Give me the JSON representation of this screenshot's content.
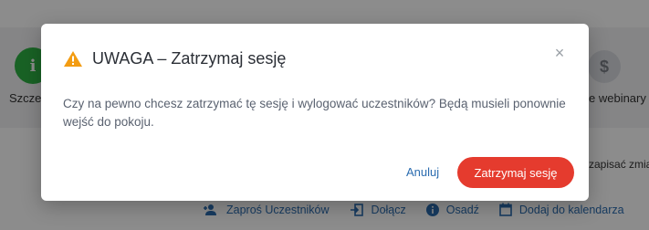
{
  "background": {
    "left_tab_icon": "info-icon",
    "left_tab_label": "Szczeg",
    "right_tab_icon": "dollar-icon",
    "right_tab_label": "e webinary",
    "save_note": "zapisać zmia",
    "actions": [
      {
        "icon": "invite-users-icon",
        "label": "Zaproś Uczestników"
      },
      {
        "icon": "join-icon",
        "label": "Dołącz"
      },
      {
        "icon": "info-icon",
        "label": "Osadź"
      },
      {
        "icon": "calendar-icon",
        "label": "Dodaj do kalendarza"
      }
    ]
  },
  "modal": {
    "icon": "warning-triangle-icon",
    "title": "UWAGA – Zatrzymaj sesję",
    "message": "Czy na pewno chcesz zatrzymać tę sesję i wylogować uczestników? Będą musieli ponownie wejść do pokoju.",
    "close_icon": "close-icon",
    "close_glyph": "×",
    "cancel_label": "Anuluj",
    "confirm_label": "Zatrzymaj sesję"
  },
  "colors": {
    "accent_blue": "#2b6cb0",
    "danger_red": "#e53b2e",
    "warning_orange": "#f39c12",
    "success_green": "#2fb344"
  }
}
